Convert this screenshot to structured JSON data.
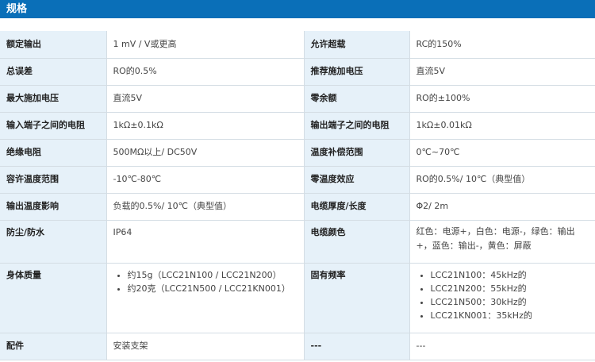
{
  "header": {
    "title": "规格"
  },
  "rows": [
    {
      "k1": "额定输出",
      "v1": "1 mV / V或更高",
      "k2": "允许超载",
      "v2": "RC的150%"
    },
    {
      "k1": "总误差",
      "v1": "RO的0.5%",
      "k2": "推荐施加电压",
      "v2": "直流5V"
    },
    {
      "k1": "最大施加电压",
      "v1": "直流5V",
      "k2": "零余额",
      "v2": "RO的±100%"
    },
    {
      "k1": "输入端子之间的电阻",
      "v1": "1kΩ±0.1kΩ",
      "k2": "输出端子之间的电阻",
      "v2": "1kΩ±0.01kΩ"
    },
    {
      "k1": "绝缘电阻",
      "v1": "500MΩ以上/ DC50V",
      "k2": "温度补偿范围",
      "v2": "0℃~70℃"
    },
    {
      "k1": "容许温度范围",
      "v1": "-10℃-80℃",
      "k2": "零温度效应",
      "v2": "RO的0.5%/ 10℃（典型值）"
    },
    {
      "k1": "输出温度影响",
      "v1": "负载的0.5%/ 10℃（典型值）",
      "k2": "电缆厚度/长度",
      "v2": "Φ2/ 2m"
    },
    {
      "k1": "防尘/防水",
      "v1": "IP64",
      "k2": "电缆颜色",
      "v2": "红色：电源+，白色：电源-，绿色：输出+，蓝色：输出-，黄色：屏蔽"
    },
    {
      "k1": "身体质量",
      "v1_list": [
        "约15g（LCC21N100 / LCC21N200）",
        "约20克（LCC21N500 / LCC21KN001）"
      ],
      "k2": "固有频率",
      "v2_list": [
        "LCC21N100：45kHz的",
        "LCC21N200：55kHz的",
        "LCC21N500：30kHz的",
        "LCC21KN001：35kHz的"
      ]
    },
    {
      "k1": "配件",
      "v1": "安装支架",
      "k2": "---",
      "v2": "---"
    }
  ]
}
